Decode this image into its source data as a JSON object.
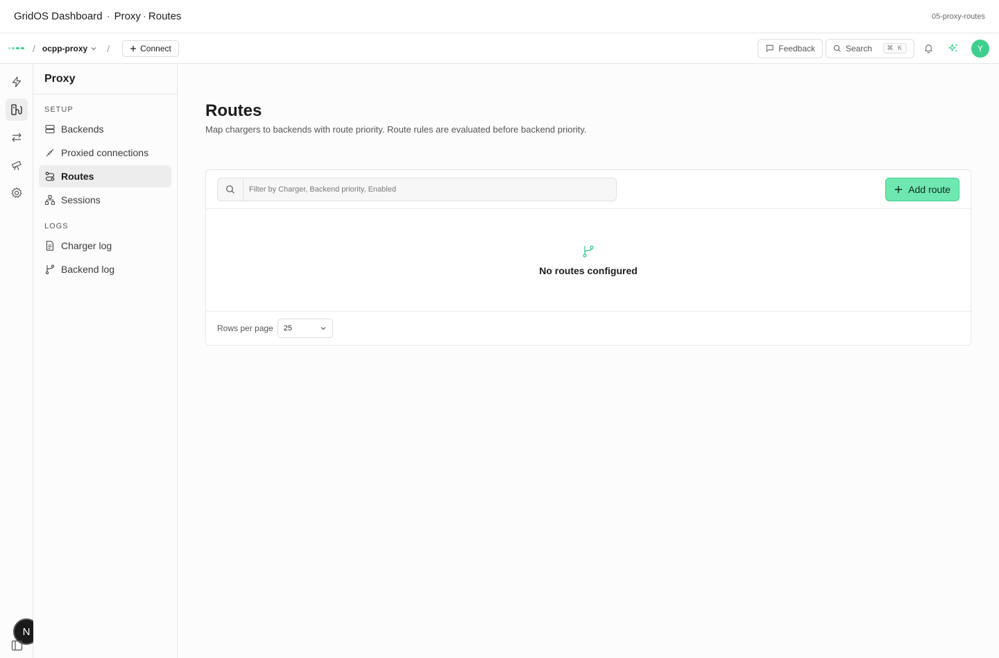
{
  "titlebar": {
    "app": "GridOS Dashboard",
    "section": "Proxy",
    "page": "Routes",
    "slug": "05-proxy-routes"
  },
  "topnav": {
    "project": "ocpp-proxy",
    "connect_label": "Connect",
    "feedback_label": "Feedback",
    "search_label": "Search",
    "search_shortcut": "⌘ K",
    "avatar_initial": "Y"
  },
  "sidebar": {
    "title": "Proxy",
    "sections": [
      {
        "label": "SETUP",
        "items": [
          {
            "label": "Backends",
            "icon": "server-icon",
            "active": false
          },
          {
            "label": "Proxied connections",
            "icon": "plug-icon",
            "active": false
          },
          {
            "label": "Routes",
            "icon": "route-icon",
            "active": true
          },
          {
            "label": "Sessions",
            "icon": "network-icon",
            "active": false
          }
        ]
      },
      {
        "label": "LOGS",
        "items": [
          {
            "label": "Charger log",
            "icon": "document-icon",
            "active": false
          },
          {
            "label": "Backend log",
            "icon": "git-branch-icon",
            "active": false
          }
        ]
      }
    ]
  },
  "rail": {
    "badge": "N"
  },
  "main": {
    "title": "Routes",
    "description": "Map chargers to backends with route priority. Route rules are evaluated before backend priority.",
    "filter_placeholder": "Filter by Charger, Backend priority, Enabled",
    "add_button": "Add route",
    "empty_message": "No routes configured",
    "rows_per_page_label": "Rows per page",
    "rows_per_page_value": "25"
  },
  "colors": {
    "accent": "#3ecf8e",
    "accent_light": "#6ee7b0"
  }
}
